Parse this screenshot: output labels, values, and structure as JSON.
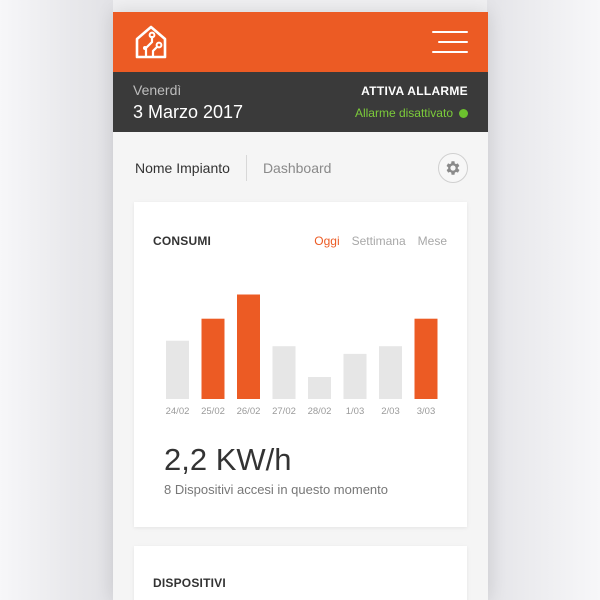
{
  "header": {
    "logo_icon": "house-circuit-icon",
    "menu_icon": "hamburger-menu-icon",
    "accent_color": "#ec5b24"
  },
  "datebar": {
    "day": "Venerdì",
    "date": "3 Marzo 2017",
    "alarm_title": "ATTIVA ALLARME",
    "alarm_status": "Allarme disattivato",
    "status_color": "#6cc12e"
  },
  "tabs": {
    "active": "Nome Impianto",
    "other": "Dashboard",
    "settings_icon": "gear-icon"
  },
  "consumi": {
    "title": "CONSUMI",
    "periods": [
      "Oggi",
      "Settimana",
      "Mese"
    ],
    "active_period": "Oggi",
    "total": "2,2 KW/h",
    "subtitle": "8 Dispositivi accesi in questo momento"
  },
  "dispositivi": {
    "title": "DISPOSITIVI"
  },
  "chart_data": {
    "type": "bar",
    "categories": [
      "24/02",
      "25/02",
      "26/02",
      "27/02",
      "28/02",
      "1/03",
      "2/03",
      "3/03"
    ],
    "values": [
      53,
      73,
      95,
      48,
      20,
      41,
      48,
      73
    ],
    "highlighted": [
      false,
      true,
      true,
      false,
      false,
      false,
      false,
      true
    ],
    "colors": {
      "highlight": "#ec5b24",
      "normal": "#e6e6e6"
    },
    "title": "",
    "xlabel": "",
    "ylabel": "",
    "ylim": [
      0,
      100
    ],
    "grid": false
  }
}
